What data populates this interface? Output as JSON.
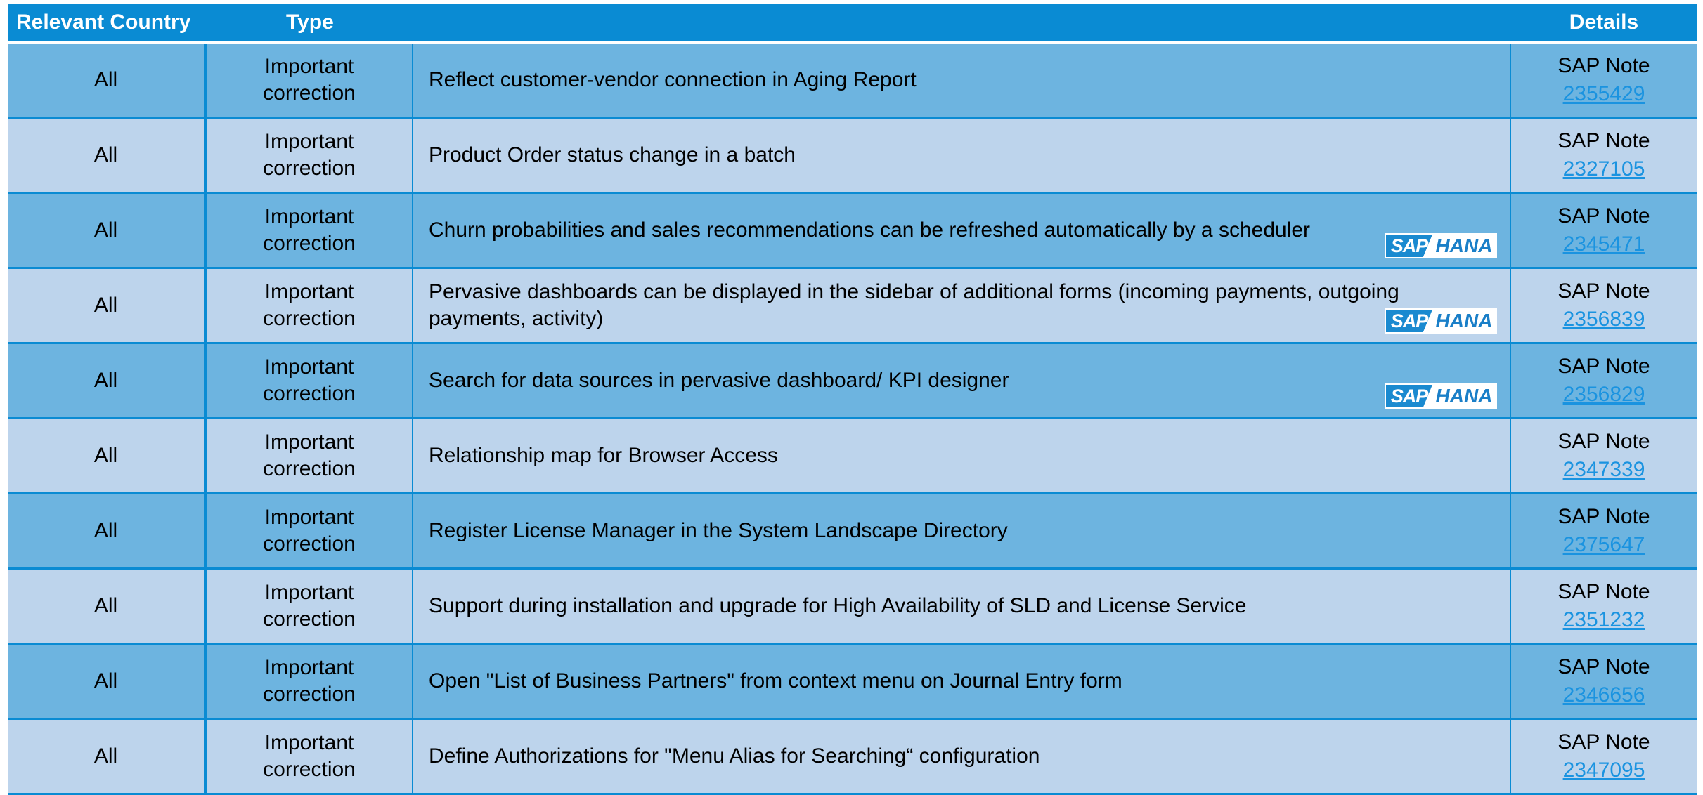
{
  "header": {
    "country": "Relevant Country",
    "type": "Type",
    "description": "",
    "details": "Details"
  },
  "hana_logo": {
    "sap": "SAP",
    "hana": "HANA"
  },
  "rows": [
    {
      "country": "All",
      "type_line1": "Important",
      "type_line2": "correction",
      "description": "Reflect customer-vendor connection in Aging Report",
      "note_label": "SAP Note",
      "note_number": "2355429",
      "hana": false
    },
    {
      "country": "All",
      "type_line1": "Important",
      "type_line2": "correction",
      "description": "Product Order status change in a batch",
      "note_label": "SAP Note",
      "note_number": "2327105",
      "hana": false
    },
    {
      "country": "All",
      "type_line1": "Important",
      "type_line2": "correction",
      "description": "Churn probabilities and sales recommendations can be refreshed automatically by a scheduler",
      "note_label": "SAP Note",
      "note_number": "2345471",
      "hana": true
    },
    {
      "country": "All",
      "type_line1": "Important",
      "type_line2": "correction",
      "description": "Pervasive dashboards can be displayed in the sidebar of additional forms (incoming payments, outgoing payments, activity)",
      "note_label": "SAP Note",
      "note_number": "2356839",
      "hana": true
    },
    {
      "country": "All",
      "type_line1": "Important",
      "type_line2": "correction",
      "description": "Search for data sources in pervasive dashboard/ KPI designer",
      "note_label": "SAP Note",
      "note_number": "2356829",
      "hana": true
    },
    {
      "country": "All",
      "type_line1": "Important",
      "type_line2": "correction",
      "description": "Relationship map for Browser Access",
      "note_label": "SAP Note",
      "note_number": "2347339",
      "hana": false
    },
    {
      "country": "All",
      "type_line1": "Important",
      "type_line2": "correction",
      "description": "Register License Manager in the System Landscape Directory",
      "note_label": "SAP Note",
      "note_number": "2375647",
      "hana": false
    },
    {
      "country": "All",
      "type_line1": "Important",
      "type_line2": "correction",
      "description": "Support during installation and upgrade for High Availability of SLD and License Service",
      "note_label": "SAP Note",
      "note_number": "2351232",
      "hana": false
    },
    {
      "country": "All",
      "type_line1": "Important",
      "type_line2": "correction",
      "description": "Open \"List of Business Partners\" from context menu on Journal Entry form",
      "note_label": "SAP Note",
      "note_number": "2346656",
      "hana": false
    },
    {
      "country": "All",
      "type_line1": "Important",
      "type_line2": "correction",
      "description": "Define Authorizations for \"Menu Alias for Searching“ configuration",
      "note_label": "SAP Note",
      "note_number": "2347095",
      "hana": false
    }
  ]
}
